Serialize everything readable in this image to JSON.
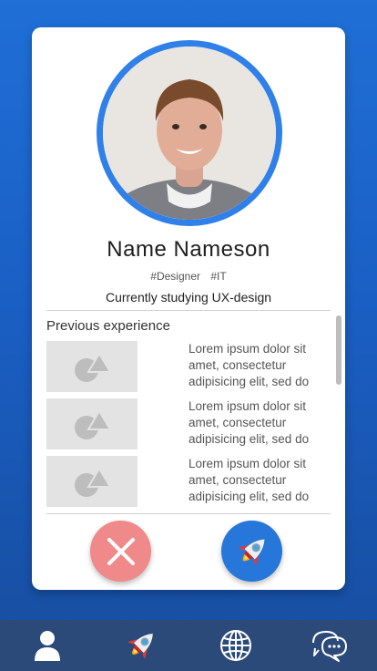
{
  "profile": {
    "name": "Name Nameson",
    "tags": [
      "#Designer",
      "#IT"
    ],
    "bio": "Currently studying UX-design"
  },
  "experience": {
    "title": "Previous experience",
    "items": [
      {
        "text": "Lorem ipsum dolor sit amet, consectetur adipisicing elit, sed do"
      },
      {
        "text": "Lorem ipsum dolor sit amet, consectetur adipisicing elit, sed do"
      },
      {
        "text": "Lorem ipsum dolor sit amet, consectetur adipisicing elit, sed do"
      }
    ]
  },
  "actions": {
    "reject_icon": "close-icon",
    "accept_icon": "rocket-icon"
  },
  "nav": {
    "items": [
      {
        "icon": "user-icon"
      },
      {
        "icon": "rocket-icon"
      },
      {
        "icon": "globe-icon"
      },
      {
        "icon": "chat-icon"
      }
    ]
  },
  "colors": {
    "accent": "#2f80e8",
    "reject": "#f08a8a",
    "nav_bg": "#2b4a7a"
  }
}
